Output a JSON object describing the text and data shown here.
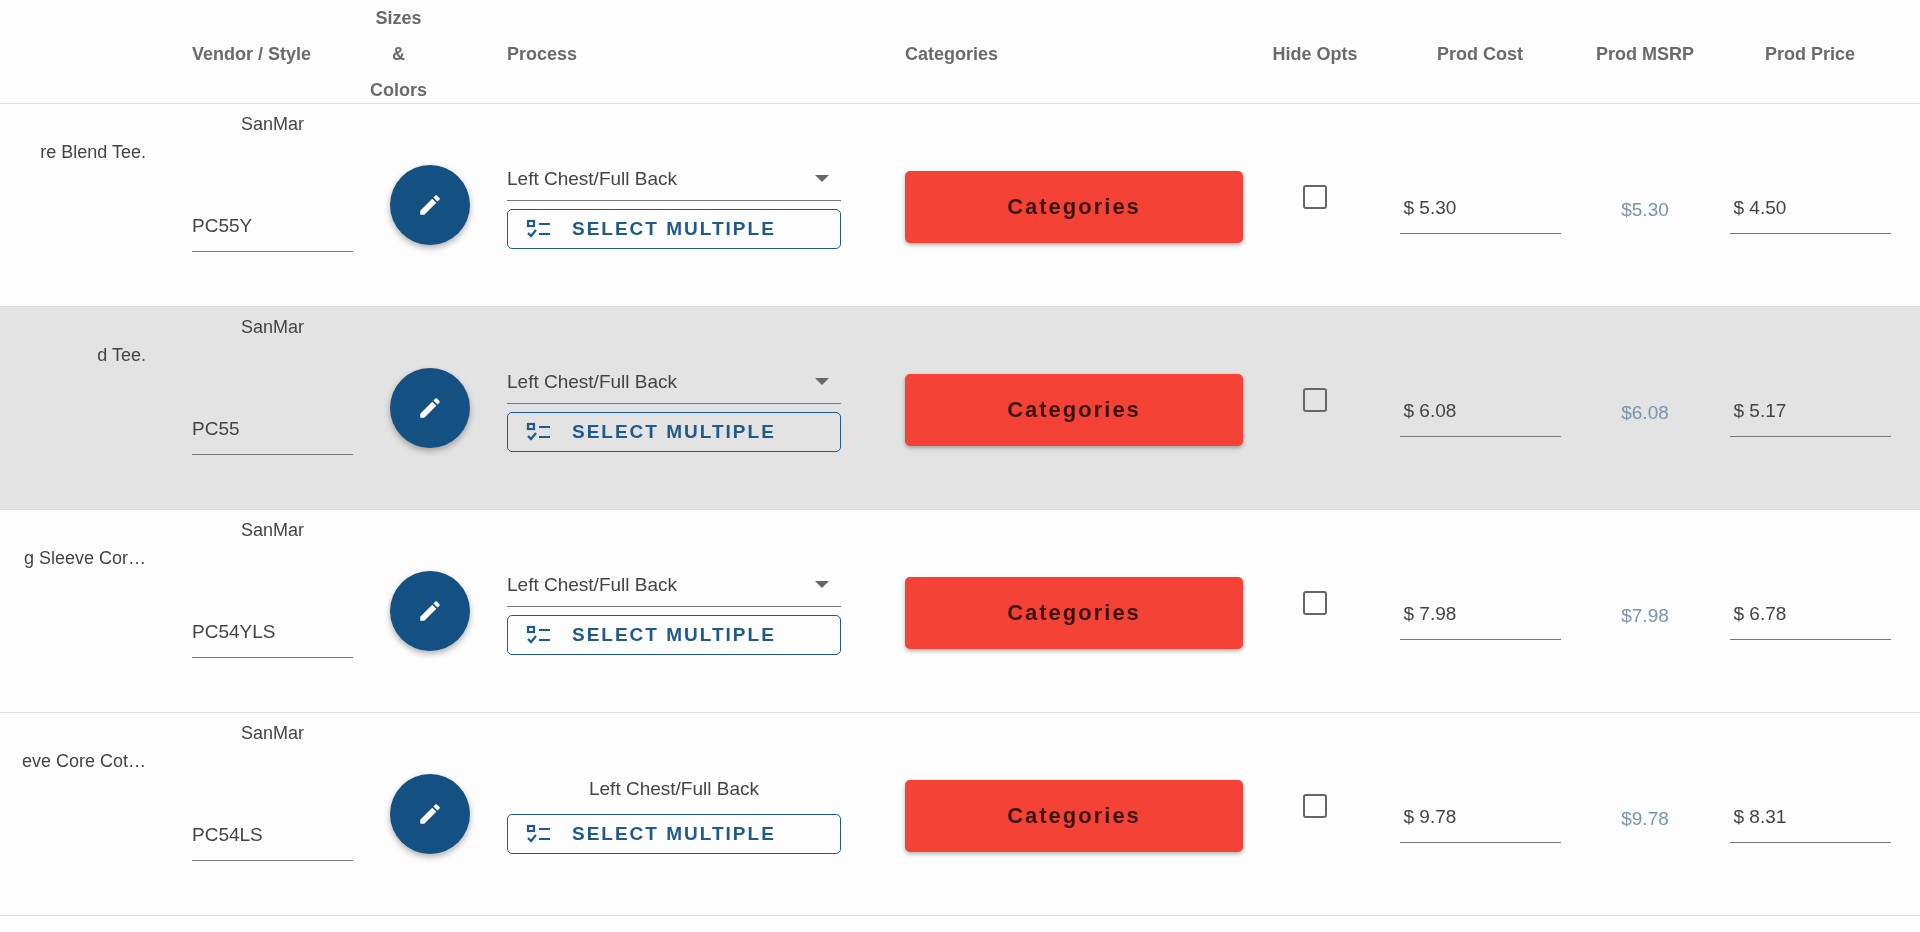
{
  "table": {
    "columns": [
      "Vendor / Style",
      "Sizes & Colors",
      "Process",
      "Categories",
      "Hide Opts",
      "Prod Cost",
      "Prod MSRP",
      "Prod Price"
    ],
    "rows": [
      {
        "description": "re Blend Tee.",
        "vendor": "SanMar",
        "style": "PC55Y",
        "highlighted": false,
        "process": {
          "kind": "select",
          "value": "Left Chest/Full Back"
        },
        "multi_button": "SELECT MULTIPLE",
        "categories_button": "Categories",
        "hide_opts": false,
        "cost": "$ 5.30",
        "msrp": "$5.30",
        "price": "$ 4.50"
      },
      {
        "description": "d Tee.",
        "vendor": "SanMar",
        "style": "PC55",
        "highlighted": true,
        "process": {
          "kind": "select",
          "value": "Left Chest/Full Back"
        },
        "multi_button": "SELECT MULTIPLE",
        "categories_button": "Categories",
        "hide_opts": false,
        "cost": "$ 6.08",
        "msrp": "$6.08",
        "price": "$ 5.17"
      },
      {
        "description": "g Sleeve Cor…",
        "vendor": "SanMar",
        "style": "PC54YLS",
        "highlighted": false,
        "process": {
          "kind": "select",
          "value": "Left Chest/Full Back"
        },
        "multi_button": "SELECT MULTIPLE",
        "categories_button": "Categories",
        "hide_opts": false,
        "cost": "$ 7.98",
        "msrp": "$7.98",
        "price": "$ 6.78"
      },
      {
        "description": "eve Core Cot…",
        "vendor": "SanMar",
        "style": "PC54LS",
        "highlighted": false,
        "process": {
          "kind": "text",
          "value": "Left Chest/Full Back"
        },
        "multi_button": "SELECT MULTIPLE",
        "categories_button": "Categories",
        "hide_opts": false,
        "cost": "$ 9.78",
        "msrp": "$9.78",
        "price": "$ 8.31"
      }
    ]
  }
}
